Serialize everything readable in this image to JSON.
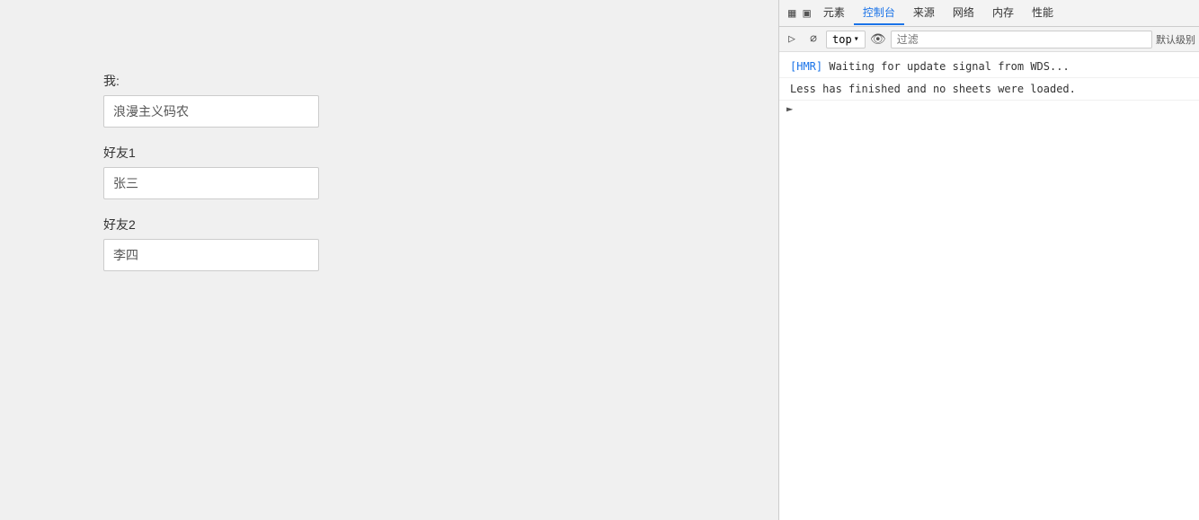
{
  "main": {
    "me_label": "我:",
    "me_value": "浪漫主义码农",
    "friend1_label": "好友1",
    "friend1_value": "张三",
    "friend2_label": "好友2",
    "friend2_value": "李四"
  },
  "devtools": {
    "top_tabs": [
      {
        "label": "元素",
        "active": false
      },
      {
        "label": "控制台",
        "active": true
      },
      {
        "label": "来源",
        "active": false
      },
      {
        "label": "网络",
        "active": false
      },
      {
        "label": "内存",
        "active": false
      },
      {
        "label": "性能",
        "active": false
      }
    ],
    "console_bar": {
      "context": "top",
      "filter_placeholder": "过滤",
      "level": "默认级别"
    },
    "messages": [
      {
        "type": "info",
        "tag": "[HMR]",
        "text": " Waiting for update signal from WDS..."
      },
      {
        "type": "normal",
        "text": "Less has finished and no sheets were loaded."
      }
    ],
    "icons": {
      "sidebar": "◧",
      "inspect": "⬚",
      "no_entry": "⊘",
      "eye": "👁",
      "chevron_down": "▾",
      "arrow": "▶"
    }
  }
}
